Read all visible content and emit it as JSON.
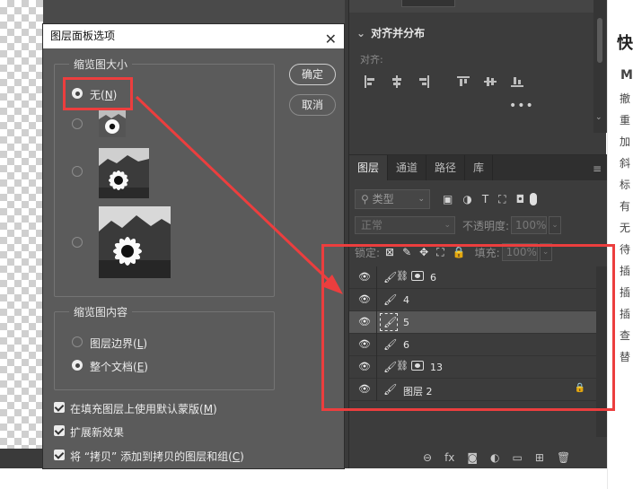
{
  "dialog": {
    "title": "图层面板选项",
    "close_glyph": "✕",
    "thumb_size_group": "缩览图大小",
    "none_label": "无(",
    "none_key": "N",
    "none_tail": ")",
    "thumb_content_group": "缩览图内容",
    "layer_bounds_label": "图层边界(",
    "layer_bounds_key": "L",
    "layer_bounds_tail": ")",
    "whole_doc_label": "整个文档(",
    "whole_doc_key": "E",
    "whole_doc_tail": ")",
    "ok_button": "确定",
    "cancel_button": "取消",
    "check1": "在填充图层上使用默认蒙版(",
    "check1_key": "M",
    "check1_tail": ")",
    "check2": "扩展新效果",
    "check3": "将 “拷贝” 添加到拷贝的图层和组(",
    "check3_key": "C",
    "check3_tail": ")"
  },
  "align_panel": {
    "header": "对齐并分布",
    "subhead": "对齐:",
    "more": "•••"
  },
  "layers_panel": {
    "tabs": [
      "图层",
      "通道",
      "路径",
      "库"
    ],
    "menu_glyph": "≡",
    "filter_label": "类型",
    "blend_mode": "正常",
    "opacity_label": "不透明度:",
    "opacity_value": "100%",
    "lock_label": "锁定:",
    "fill_label": "填充:",
    "fill_value": "100%",
    "layers": [
      {
        "name": "6",
        "extra": true
      },
      {
        "name": "4",
        "extra": false
      },
      {
        "name": "5",
        "extra": false,
        "selected": true
      },
      {
        "name": "6",
        "extra": false
      },
      {
        "name": "13",
        "extra": true
      },
      {
        "name": "图层 2",
        "extra": false,
        "locked": true
      }
    ],
    "bottom_icons": [
      "⊖",
      "fx",
      "◙",
      "◐",
      "▭",
      "⊞",
      "🗑"
    ]
  },
  "right_sidebar": {
    "title": "快",
    "subtitle": "M",
    "items": [
      "撤",
      "重",
      "加",
      "斜",
      "标",
      "有",
      "无",
      "待",
      "插",
      "插",
      "插",
      "查",
      "替"
    ]
  },
  "colors": {
    "highlight_red": "#ec3e3e",
    "dialog_bg": "#5b5b5b",
    "panel_bg": "#3c3c3c"
  }
}
